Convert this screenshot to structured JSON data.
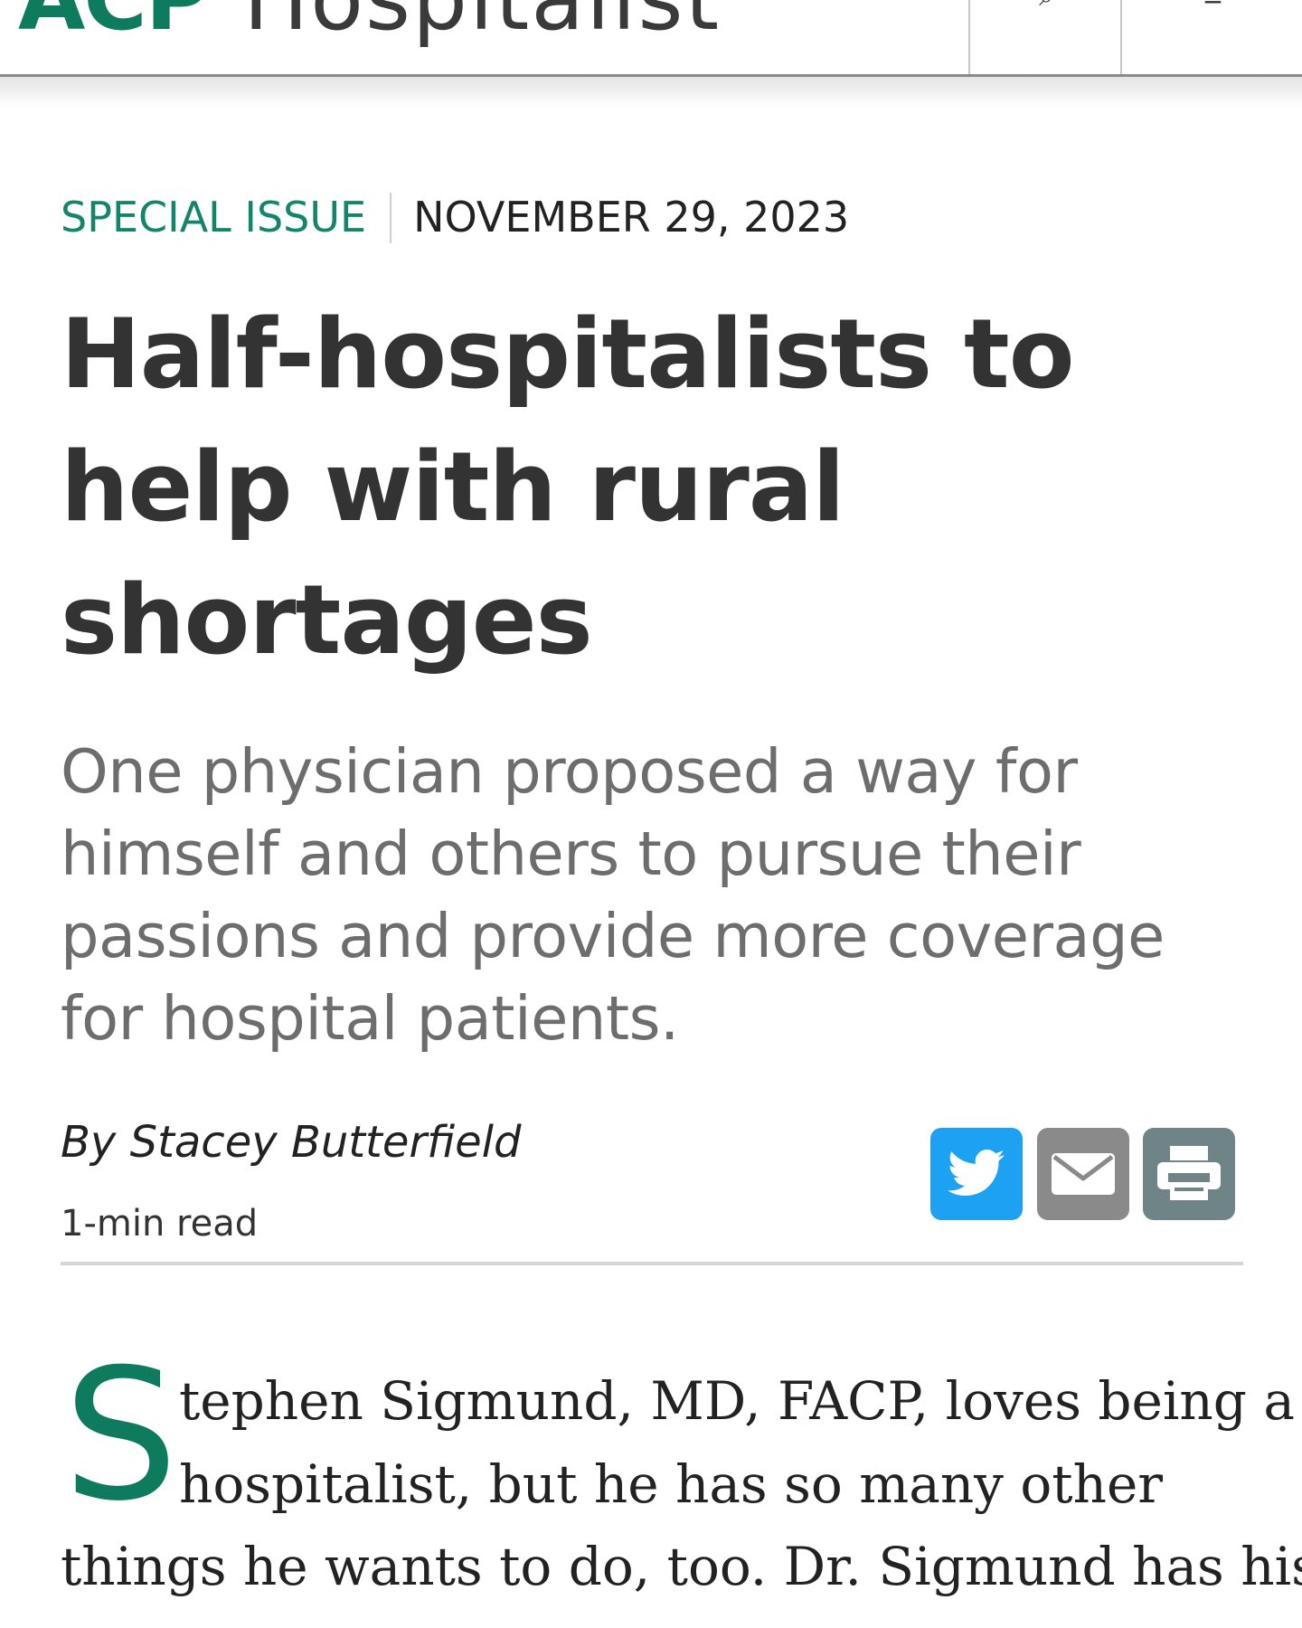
{
  "header": {
    "brand_acp": "ACP",
    "brand_name": "Hospitalist",
    "search_icon": "search-icon",
    "menu_icon": "menu-icon"
  },
  "article": {
    "section": "SPECIAL ISSUE",
    "date": "NOVEMBER 29, 2023",
    "headline": "Half-hospitalists to help with rural shortages",
    "dek": "One physician proposed a way for himself and others to pursue their passions and provide more coverage for hospital patients.",
    "byline": "By Stacey Butterfield",
    "read_time": "1-min read",
    "share": {
      "twitter_icon": "twitter-icon",
      "email_icon": "email-icon",
      "print_icon": "print-icon"
    },
    "body": {
      "drop_cap": "S",
      "line1": "tephen Sigmund, MD, FACP, loves being a",
      "line2": "hospitalist, but he has so many other",
      "line3": "things he wants to do, too. Dr. Sigmund has his"
    }
  },
  "colors": {
    "brand_green": "#0e7a5e",
    "twitter_blue": "#1da1f2",
    "email_gray": "#8a8a8a",
    "print_slate": "#6f8486"
  }
}
